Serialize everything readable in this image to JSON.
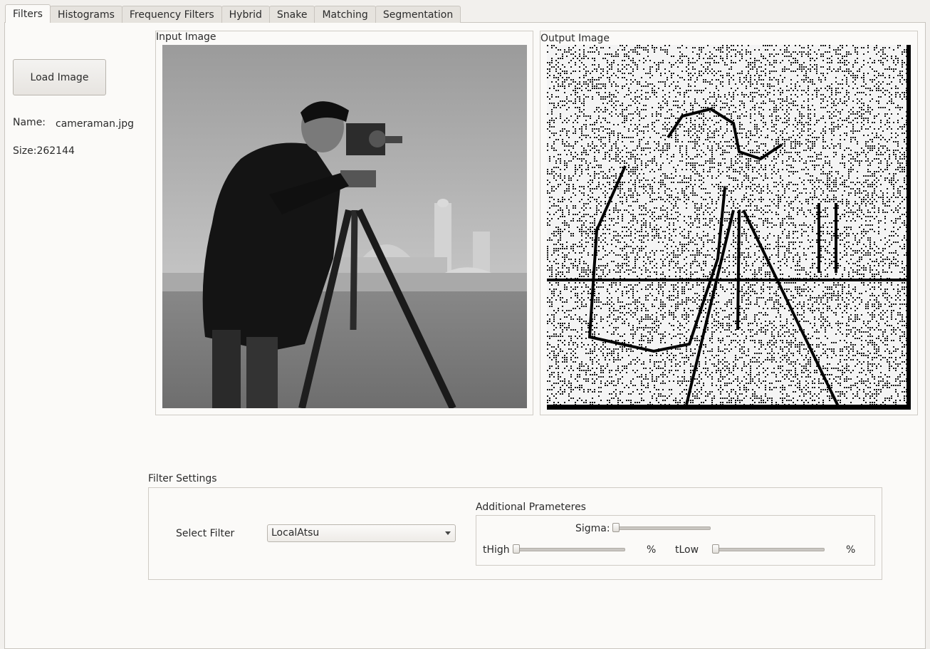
{
  "tabs": [
    "Filters",
    "Histograms",
    "Frequency Filters",
    "Hybrid",
    "Snake",
    "Matching",
    "Segmentation"
  ],
  "active_tab": 0,
  "left_panel": {
    "load_button": "Load Image",
    "name_label": "Name:",
    "name_value": "cameraman.jpg",
    "size_text": "Size:262144"
  },
  "images": {
    "input_title": "Input Image",
    "output_title": "Output Image"
  },
  "filter_settings": {
    "title": "Filter Settings",
    "select_label": "Select Filter",
    "selected_filter": "LocalAtsu",
    "additional_title": "Additional Prameteres",
    "sigma_label": "Sigma:",
    "sigma_value": 0,
    "thigh_label": "tHigh",
    "thigh_value": 0,
    "thigh_unit": "%",
    "tlow_label": "tLow",
    "tlow_value": 0,
    "tlow_unit": "%"
  },
  "icons": {
    "combo_arrow": "chevron-down-icon"
  }
}
